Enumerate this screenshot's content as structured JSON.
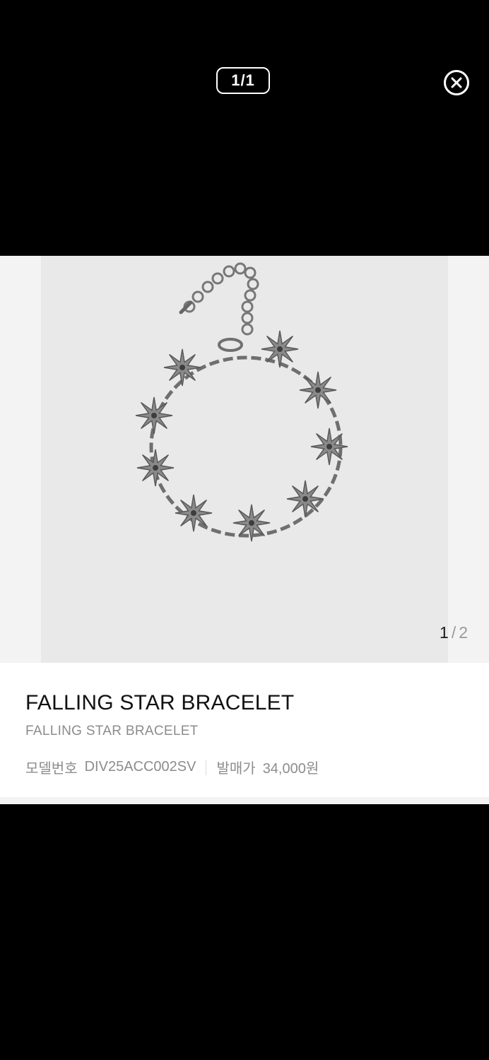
{
  "viewer": {
    "page_indicator": "1/1",
    "close_icon": "close-circle-icon"
  },
  "gallery": {
    "current": "1",
    "separator": "/",
    "total": "2",
    "colors": {
      "photo_bg": "#e9e9ea",
      "metal": "#8a8a8a"
    }
  },
  "product": {
    "title": "FALLING STAR BRACELET",
    "subtitle": "FALLING STAR BRACELET",
    "model_label": "모델번호",
    "model_value": "DIV25ACC002SV",
    "price_label": "발매가",
    "price_value": "34,000원"
  }
}
